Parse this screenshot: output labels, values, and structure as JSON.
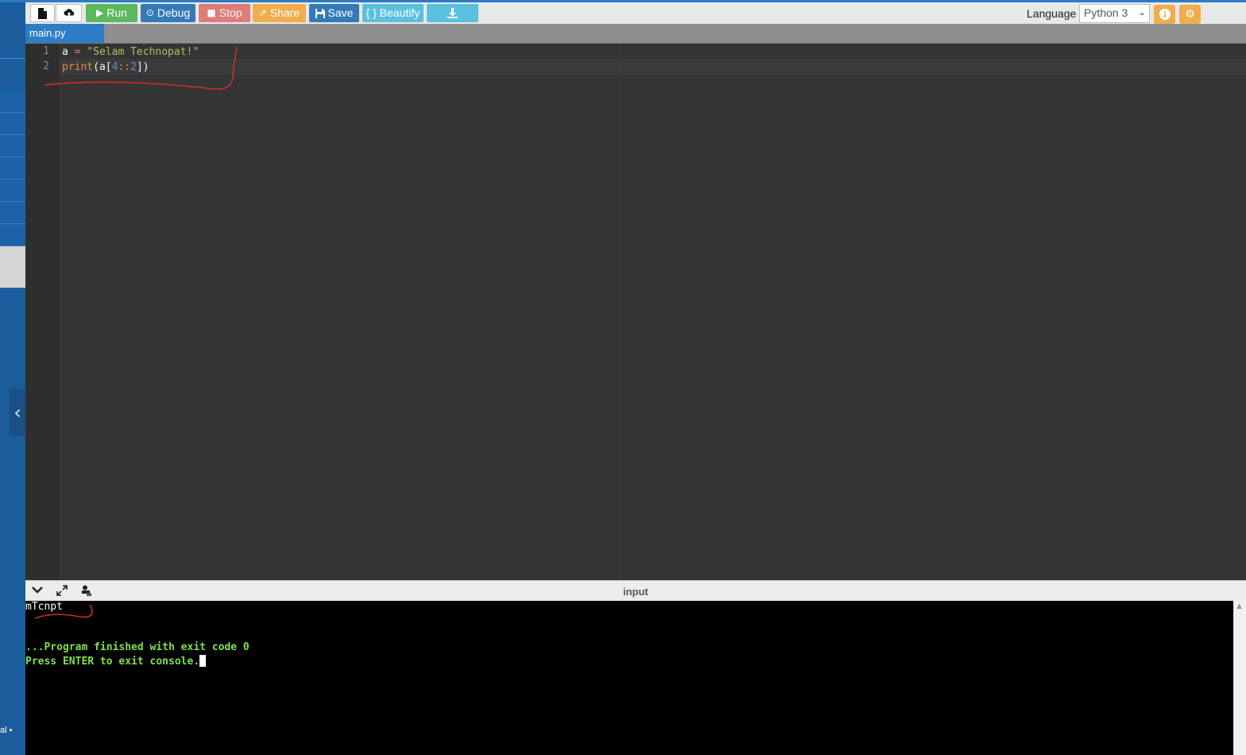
{
  "toolbar": {
    "new_file_icon": "file-icon",
    "upload_icon": "upload-icon",
    "run_label": "Run",
    "debug_label": "Debug",
    "stop_label": "Stop",
    "share_label": "Share",
    "save_label": "Save",
    "beautify_label": "{ } Beautify",
    "download_icon": "download-icon",
    "language_label": "Language",
    "language_value": "Python 3",
    "info_icon": "info-icon",
    "settings_icon": "gear-icon",
    "colors": {
      "run": "#5cb85c",
      "debug": "#337ab7",
      "stop": "#d9534f",
      "share": "#f0ad4e",
      "save": "#337ab7",
      "beautify": "#5bc0de",
      "download": "#5bc0de"
    }
  },
  "sidebar": {
    "collapse_icon": "chevron-left-icon",
    "footer_text": "al ▪"
  },
  "tabs": [
    {
      "label": "main.py",
      "active": true
    }
  ],
  "editor": {
    "lines": [
      {
        "number": "1",
        "tokens": [
          {
            "text": "a",
            "type": "var"
          },
          {
            "text": " = ",
            "type": "op"
          },
          {
            "text": "\"Selam Technopat!\"",
            "type": "str"
          }
        ]
      },
      {
        "number": "2",
        "tokens": [
          {
            "text": "print",
            "type": "kw"
          },
          {
            "text": "(a[",
            "type": "bracket"
          },
          {
            "text": "4",
            "type": "num"
          },
          {
            "text": "::",
            "type": "op"
          },
          {
            "text": "2",
            "type": "num"
          },
          {
            "text": "])",
            "type": "bracket"
          }
        ]
      }
    ]
  },
  "console_header": {
    "collapse_icon": "chevron-down-icon",
    "expand_icon": "expand-icon",
    "clear_icon": "eraser-icon",
    "input_label": "input"
  },
  "console": {
    "output": "mTcnpt",
    "finished": "...Program finished with exit code 0",
    "press_enter": "Press ENTER to exit console."
  }
}
